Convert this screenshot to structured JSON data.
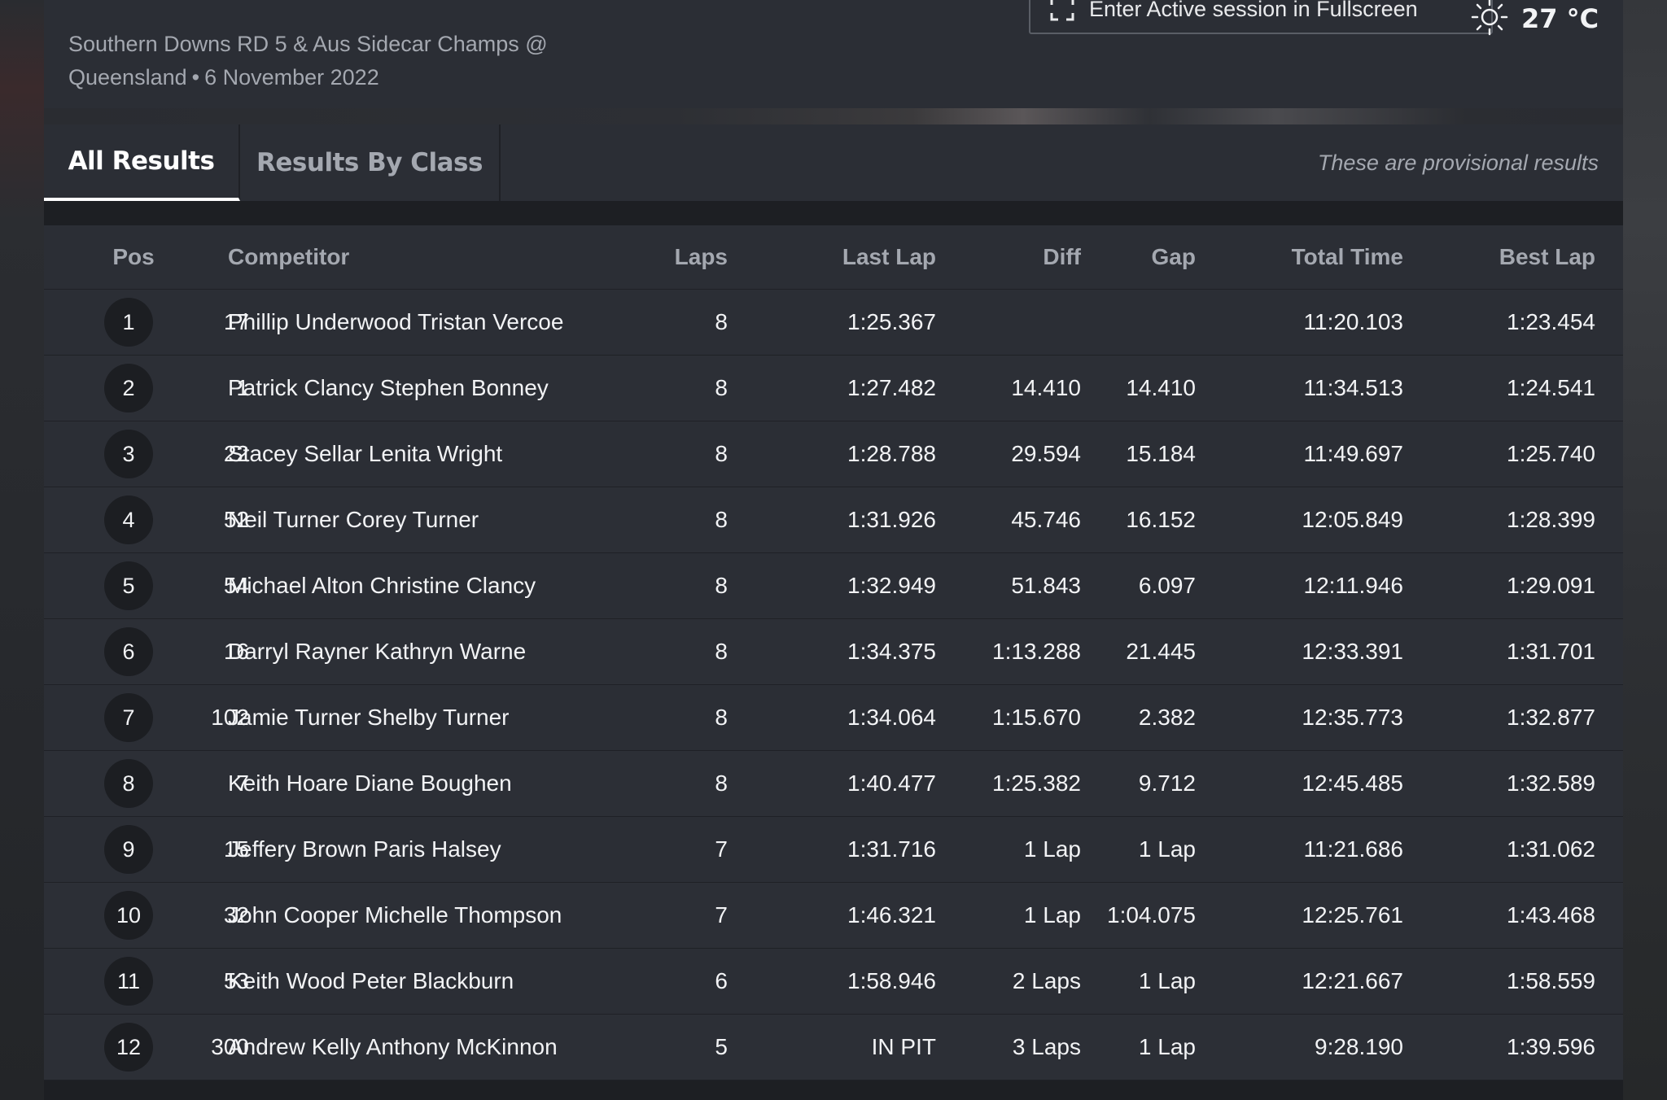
{
  "event": {
    "line1": "Southern Downs RD 5 & Aus Sidecar Champs @",
    "location": "Queensland",
    "separator": "•",
    "date": "6 November 2022"
  },
  "fullscreen_button": {
    "label": "Enter Active session in Fullscreen",
    "icon": "fullscreen-icon"
  },
  "weather": {
    "icon": "sun-icon",
    "temperature": "27 °C"
  },
  "tabs": [
    {
      "label": "All Results",
      "active": true
    },
    {
      "label": "Results By Class",
      "active": false
    }
  ],
  "provisional_note": "These are provisional results",
  "columns": {
    "pos": "Pos",
    "competitor": "Competitor",
    "laps": "Laps",
    "last_lap": "Last Lap",
    "diff": "Diff",
    "gap": "Gap",
    "total_time": "Total Time",
    "best_lap": "Best Lap"
  },
  "results": [
    {
      "pos": "1",
      "num": "17",
      "name": "Phillip Underwood Tristan Vercoe",
      "laps": "8",
      "last_lap": "1:25.367",
      "diff": "",
      "gap": "",
      "total": "11:20.103",
      "best": "1:23.454"
    },
    {
      "pos": "2",
      "num": "1",
      "name": "Patrick Clancy Stephen Bonney",
      "laps": "8",
      "last_lap": "1:27.482",
      "diff": "14.410",
      "gap": "14.410",
      "total": "11:34.513",
      "best": "1:24.541"
    },
    {
      "pos": "3",
      "num": "22",
      "name": "Stacey Sellar Lenita Wright",
      "laps": "8",
      "last_lap": "1:28.788",
      "diff": "29.594",
      "gap": "15.184",
      "total": "11:49.697",
      "best": "1:25.740"
    },
    {
      "pos": "4",
      "num": "52",
      "name": "Neil Turner Corey Turner",
      "laps": "8",
      "last_lap": "1:31.926",
      "diff": "45.746",
      "gap": "16.152",
      "total": "12:05.849",
      "best": "1:28.399"
    },
    {
      "pos": "5",
      "num": "54",
      "name": "Michael Alton Christine Clancy",
      "laps": "8",
      "last_lap": "1:32.949",
      "diff": "51.843",
      "gap": "6.097",
      "total": "12:11.946",
      "best": "1:29.091"
    },
    {
      "pos": "6",
      "num": "16",
      "name": "Darryl Rayner Kathryn Warne",
      "laps": "8",
      "last_lap": "1:34.375",
      "diff": "1:13.288",
      "gap": "21.445",
      "total": "12:33.391",
      "best": "1:31.701"
    },
    {
      "pos": "7",
      "num": "102",
      "name": "Jamie Turner Shelby Turner",
      "laps": "8",
      "last_lap": "1:34.064",
      "diff": "1:15.670",
      "gap": "2.382",
      "total": "12:35.773",
      "best": "1:32.877"
    },
    {
      "pos": "8",
      "num": "7",
      "name": "Keith Hoare Diane Boughen",
      "laps": "8",
      "last_lap": "1:40.477",
      "diff": "1:25.382",
      "gap": "9.712",
      "total": "12:45.485",
      "best": "1:32.589"
    },
    {
      "pos": "9",
      "num": "15",
      "name": "Jeffery Brown Paris Halsey",
      "laps": "7",
      "last_lap": "1:31.716",
      "diff": "1 Lap",
      "gap": "1 Lap",
      "total": "11:21.686",
      "best": "1:31.062"
    },
    {
      "pos": "10",
      "num": "32",
      "name": "John Cooper Michelle Thompson",
      "laps": "7",
      "last_lap": "1:46.321",
      "diff": "1 Lap",
      "gap": "1:04.075",
      "total": "12:25.761",
      "best": "1:43.468"
    },
    {
      "pos": "11",
      "num": "53",
      "name": "Keith Wood Peter Blackburn",
      "laps": "6",
      "last_lap": "1:58.946",
      "diff": "2 Laps",
      "gap": "1 Lap",
      "total": "12:21.667",
      "best": "1:58.559"
    },
    {
      "pos": "12",
      "num": "300",
      "name": "Andrew Kelly Anthony McKinnon",
      "laps": "5",
      "last_lap": "IN PIT",
      "diff": "3 Laps",
      "gap": "1 Lap",
      "total": "9:28.190",
      "best": "1:39.596"
    }
  ]
}
